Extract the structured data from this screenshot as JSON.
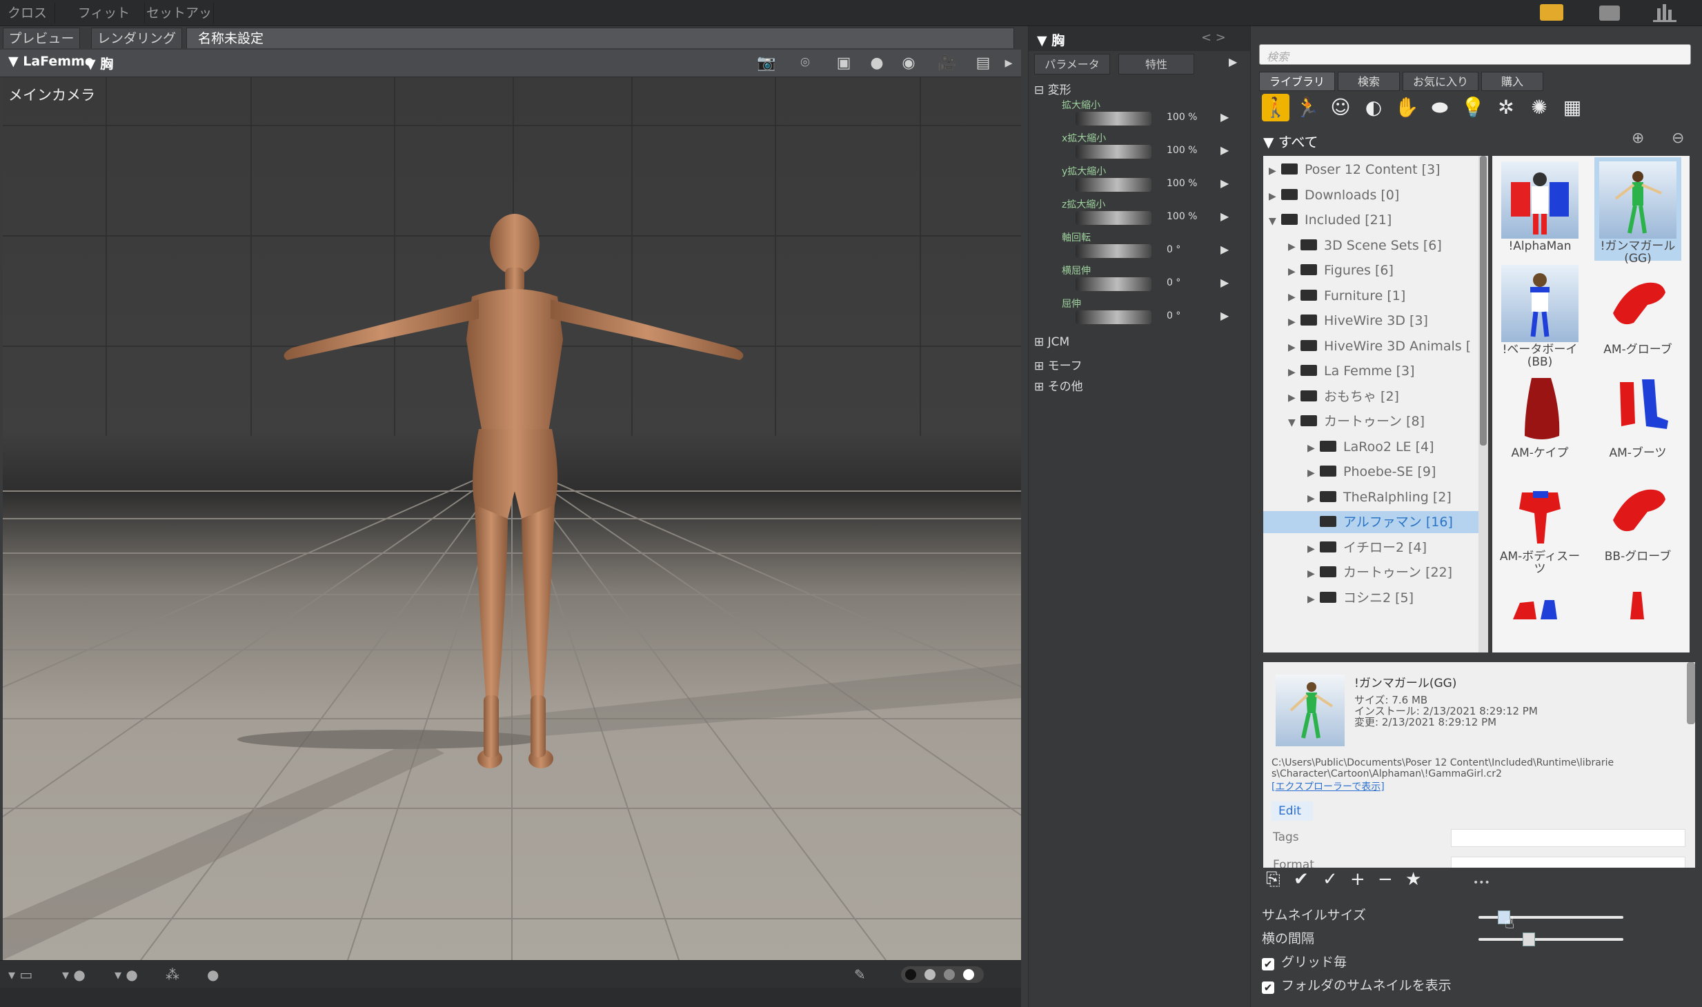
{
  "top_tabs": [
    "クロス",
    "フィット",
    "セットアップ"
  ],
  "subtabs": [
    "プレビュー",
    "レンダリング",
    "名称未設定"
  ],
  "viewport": {
    "figure_select": "LaFemme",
    "part_select": "胸",
    "camera_label": "メインカメラ"
  },
  "param_panel": {
    "title": "胸",
    "nav": "< >",
    "tabs": [
      "パラメータ",
      "特性"
    ],
    "group_transform": "変形",
    "params": [
      {
        "label": "拡大縮小",
        "value": "100 %"
      },
      {
        "label": "x拡大縮小",
        "value": "100 %"
      },
      {
        "label": "y拡大縮小",
        "value": "100 %"
      },
      {
        "label": "z拡大縮小",
        "value": "100 %"
      },
      {
        "label": "軸回転",
        "value": "0 °"
      },
      {
        "label": "横屈伸",
        "value": "0 °"
      },
      {
        "label": "屈伸",
        "value": "0 °"
      }
    ],
    "groups": [
      "JCM",
      "モーフ",
      "その他"
    ]
  },
  "library": {
    "search_placeholder": "検索",
    "tabs": [
      "ライブラリ",
      "検索",
      "お気に入り",
      "購入"
    ],
    "all_label": "すべて",
    "tree": [
      {
        "label": "Poser 12 Content [3]",
        "level": 0,
        "arrow": "▶"
      },
      {
        "label": "Downloads [0]",
        "level": 0,
        "arrow": "▶"
      },
      {
        "label": "Included [21]",
        "level": 0,
        "arrow": "▼"
      },
      {
        "label": "3D Scene Sets [6]",
        "level": 1,
        "arrow": "▶"
      },
      {
        "label": "Figures [6]",
        "level": 1,
        "arrow": "▶"
      },
      {
        "label": "Furniture [1]",
        "level": 1,
        "arrow": "▶"
      },
      {
        "label": "HiveWire 3D [3]",
        "level": 1,
        "arrow": "▶"
      },
      {
        "label": "HiveWire 3D Animals [",
        "level": 1,
        "arrow": "▶"
      },
      {
        "label": "La Femme [3]",
        "level": 1,
        "arrow": "▶"
      },
      {
        "label": "おもちゃ [2]",
        "level": 1,
        "arrow": "▶"
      },
      {
        "label": "カートゥーン [8]",
        "level": 1,
        "arrow": "▼"
      },
      {
        "label": "LaRoo2 LE [4]",
        "level": 2,
        "arrow": "▶"
      },
      {
        "label": "Phoebe-SE [9]",
        "level": 2,
        "arrow": "▶"
      },
      {
        "label": "TheRalphling [2]",
        "level": 2,
        "arrow": "▶"
      },
      {
        "label": "アルファマン [16]",
        "level": 2,
        "arrow": "",
        "selected": true
      },
      {
        "label": "イチロー2 [4]",
        "level": 2,
        "arrow": "▶"
      },
      {
        "label": "カートゥーン [22]",
        "level": 2,
        "arrow": "▶"
      },
      {
        "label": "コシニ2 [5]",
        "level": 2,
        "arrow": "▶"
      }
    ],
    "thumbnails": [
      {
        "label": "!AlphaMan",
        "icon": "alphaman-figure"
      },
      {
        "label": "!ガンマガール (GG)",
        "icon": "gammagirl-figure",
        "selected": true
      },
      {
        "label": "!ベータボーイ (BB)",
        "icon": "betaboy-figure"
      },
      {
        "label": "AM-グローブ",
        "icon": "glove"
      },
      {
        "label": "AM-ケイプ",
        "icon": "cape"
      },
      {
        "label": "AM-ブーツ",
        "icon": "boots"
      },
      {
        "label": "AM-ボディスーツ",
        "icon": "bodysuit"
      },
      {
        "label": "BB-グローブ",
        "icon": "glove"
      }
    ],
    "info": {
      "name": "!ガンマガール(GG)",
      "size": "サイズ: 7.6 MB",
      "installed": "インストール: 2/13/2021 8:29:12 PM",
      "modified": "変更: 2/13/2021 8:29:12 PM",
      "path_line1": "C:\\Users\\Public\\Documents\\Poser 12 Content\\Included\\Runtime\\librarie",
      "path_line2": "s\\Character\\Cartoon\\Alphaman\\!GammaGirl.cr2",
      "explorer_link": "[エクスプローラーで表示]",
      "edit": "Edit",
      "tags": "Tags",
      "format": "Format"
    },
    "settings": {
      "thumb_size": "サムネイルサイズ",
      "spacing": "横の間隔",
      "grid_snap": "グリッド毎",
      "show_folder_thumbs": "フォルダのサムネイルを表示",
      "dots": "•••"
    }
  }
}
